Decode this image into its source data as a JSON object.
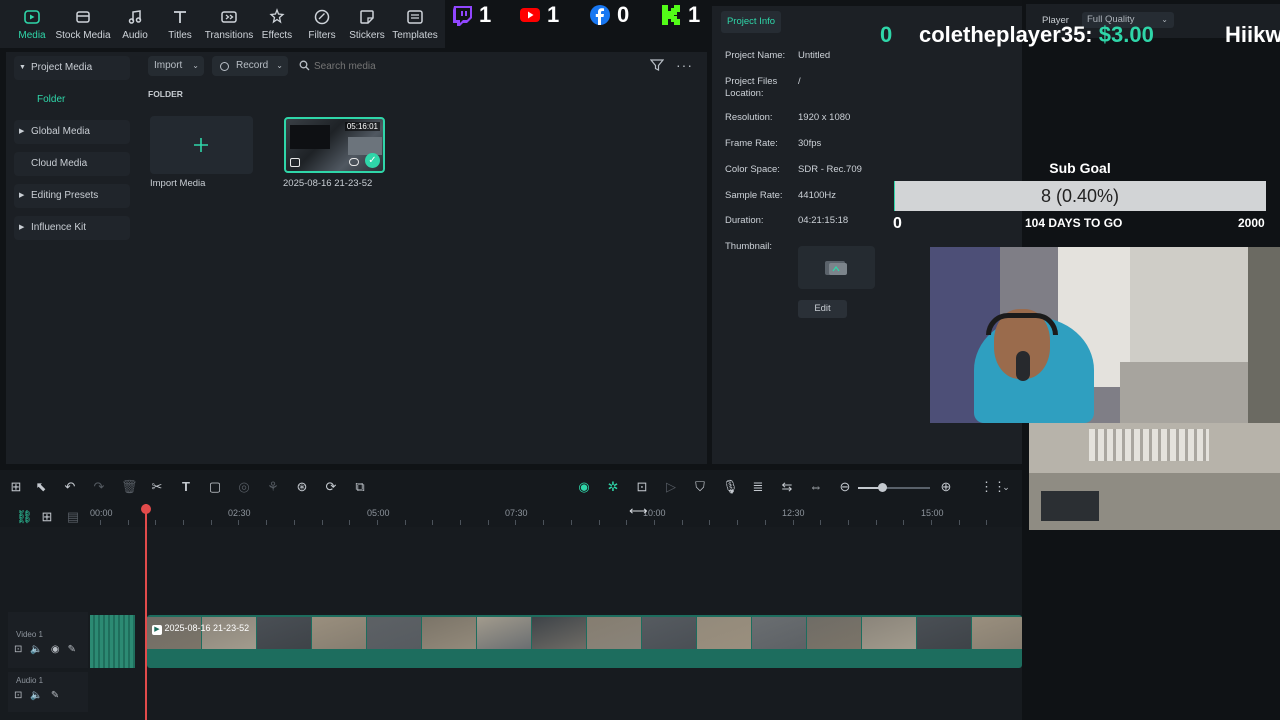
{
  "toolbar": {
    "tabs": [
      {
        "label": "Media",
        "icon": "media-icon"
      },
      {
        "label": "Stock Media",
        "icon": "stock-media-icon"
      },
      {
        "label": "Audio",
        "icon": "audio-icon"
      },
      {
        "label": "Titles",
        "icon": "titles-icon"
      },
      {
        "label": "Transitions",
        "icon": "transitions-icon"
      },
      {
        "label": "Effects",
        "icon": "effects-icon"
      },
      {
        "label": "Filters",
        "icon": "filters-icon"
      },
      {
        "label": "Stickers",
        "icon": "stickers-icon"
      },
      {
        "label": "Templates",
        "icon": "templates-icon"
      }
    ],
    "active_tab": "Media",
    "accent": "#2fd6a9"
  },
  "social": {
    "twitch": "1",
    "youtube": "1",
    "facebook": "0",
    "kick": "1"
  },
  "leftnav": {
    "project_media": "Project Media",
    "folder": "Folder",
    "global_media": "Global Media",
    "cloud_media": "Cloud Media",
    "editing_presets": "Editing Presets",
    "influence_kit": "Influence Kit"
  },
  "media": {
    "import_label": "Import",
    "record_label": "Record",
    "search_placeholder": "Search media",
    "folder_heading": "FOLDER",
    "import_tile_label": "Import Media",
    "clip_name": "2025-08-16 21-23-52",
    "clip_duration": "05:16:01"
  },
  "project_info": {
    "tab": "Project Info",
    "rows": [
      {
        "label": "Project Name:",
        "value": "Untitled"
      },
      {
        "label": "Project Files Location:",
        "value": "/"
      },
      {
        "label": "Resolution:",
        "value": "1920 x 1080"
      },
      {
        "label": "Frame Rate:",
        "value": "30fps"
      },
      {
        "label": "Color Space:",
        "value": "SDR - Rec.709"
      },
      {
        "label": "Sample Rate:",
        "value": "44100Hz"
      },
      {
        "label": "Duration:",
        "value": "04:21:15:18"
      },
      {
        "label": "Thumbnail:",
        "value": ""
      }
    ],
    "edit_label": "Edit"
  },
  "player": {
    "label": "Player",
    "quality": "Full Quality"
  },
  "overlay": {
    "donation_user": "coletheplayer35:",
    "donation_amount": "$3.00",
    "ticker_tail": "Hiikw",
    "ticker_head": "0",
    "sub_goal_title": "Sub Goal",
    "sub_goal_value": "8 (0.40%)",
    "sub_goal_progress": 0.004,
    "sub_goal_min": "0",
    "sub_goal_max": "2000",
    "days_to_go": "104 DAYS TO GO"
  },
  "timeline": {
    "ruler_labels": [
      "00:00",
      "02:30",
      "05:00",
      "07:30",
      "10:00",
      "12:30",
      "15:00"
    ],
    "video_track": "Video 1",
    "audio_track": "Audio 1",
    "clip_label": "2025-08-16 21-23-52"
  }
}
